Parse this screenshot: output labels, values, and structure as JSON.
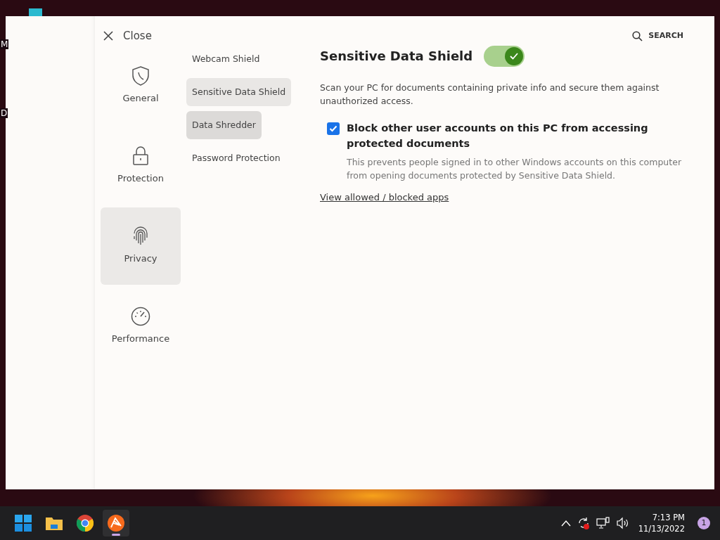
{
  "desktop_labels": [
    "M",
    "D"
  ],
  "dialog": {
    "close_label": "Close",
    "search_label": "SEARCH",
    "categories": [
      {
        "label": "General",
        "kind": "shield",
        "selected": false
      },
      {
        "label": "Protection",
        "kind": "lock",
        "selected": false
      },
      {
        "label": "Privacy",
        "kind": "fingerprint",
        "selected": true
      },
      {
        "label": "Performance",
        "kind": "gauge",
        "selected": false
      }
    ],
    "subnav": [
      {
        "label": "Webcam Shield",
        "selected": false,
        "hovered": false
      },
      {
        "label": "Sensitive Data Shield",
        "selected": true,
        "hovered": false
      },
      {
        "label": "Data Shredder",
        "selected": false,
        "hovered": true
      },
      {
        "label": "Password Protection",
        "selected": false,
        "hovered": false
      }
    ],
    "content": {
      "title": "Sensitive Data Shield",
      "enabled": true,
      "description": "Scan your PC for documents containing private info and secure them against unauthorized access.",
      "option": {
        "label": "Block other user accounts on this PC from accessing protected documents",
        "checked": true,
        "help": "This prevents people signed in to other Windows accounts on this computer from opening documents protected by Sensitive Data Shield."
      },
      "link": "View allowed / blocked apps"
    }
  },
  "taskbar": {
    "apps": [
      {
        "kind": "start",
        "active": false
      },
      {
        "kind": "folder",
        "active": false
      },
      {
        "kind": "browser",
        "active": false
      },
      {
        "kind": "antivirus",
        "active": true
      }
    ],
    "time": "7:13 PM",
    "date": "11/13/2022",
    "notifications": "1"
  }
}
